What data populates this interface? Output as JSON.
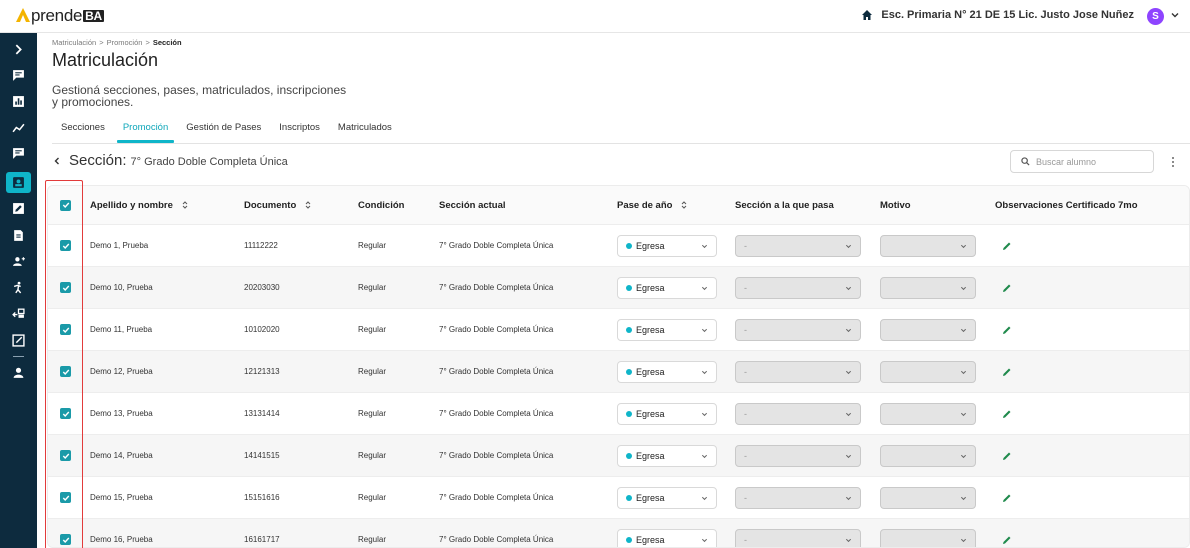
{
  "app": {
    "logo_text": "prende",
    "logo_suffix": "BA"
  },
  "header": {
    "school": "Esc. Primaria N° 21 DE 15 Lic. Justo Jose Nuñez",
    "avatar_initial": "S"
  },
  "breadcrumb": {
    "items": [
      "Matriculación",
      ">",
      "Promoción",
      ">",
      "Sección"
    ]
  },
  "page": {
    "title": "Matriculación",
    "description": "Gestioná secciones, pases, matriculados, inscripciones y promociones."
  },
  "tabs": [
    "Secciones",
    "Promoción",
    "Gestión de Pases",
    "Inscriptos",
    "Matriculados"
  ],
  "active_tab": "Promoción",
  "section": {
    "label": "Sección:",
    "name": "7° Grado Doble Completa Única"
  },
  "search": {
    "placeholder": "Buscar alumno"
  },
  "table": {
    "headers": [
      "Apellido y nombre",
      "Documento",
      "Condición",
      "Sección actual",
      "Pase de año",
      "Sección a la que pasa",
      "Motivo",
      "Observaciones Certificado 7mo"
    ],
    "rows": [
      {
        "name": "Demo 1, Prueba",
        "documento": "11112222",
        "condicion": "Regular",
        "seccion": "7° Grado Doble Completa Única",
        "pase": "Egresa",
        "seccion_pasa": "-",
        "motivo": ""
      },
      {
        "name": "Demo 10, Prueba",
        "documento": "20203030",
        "condicion": "Regular",
        "seccion": "7° Grado Doble Completa Única",
        "pase": "Egresa",
        "seccion_pasa": "-",
        "motivo": ""
      },
      {
        "name": "Demo 11, Prueba",
        "documento": "10102020",
        "condicion": "Regular",
        "seccion": "7° Grado Doble Completa Única",
        "pase": "Egresa",
        "seccion_pasa": "-",
        "motivo": ""
      },
      {
        "name": "Demo 12, Prueba",
        "documento": "12121313",
        "condicion": "Regular",
        "seccion": "7° Grado Doble Completa Única",
        "pase": "Egresa",
        "seccion_pasa": "-",
        "motivo": ""
      },
      {
        "name": "Demo 13, Prueba",
        "documento": "13131414",
        "condicion": "Regular",
        "seccion": "7° Grado Doble Completa Única",
        "pase": "Egresa",
        "seccion_pasa": "-",
        "motivo": ""
      },
      {
        "name": "Demo 14, Prueba",
        "documento": "14141515",
        "condicion": "Regular",
        "seccion": "7° Grado Doble Completa Única",
        "pase": "Egresa",
        "seccion_pasa": "-",
        "motivo": ""
      },
      {
        "name": "Demo 15, Prueba",
        "documento": "15151616",
        "condicion": "Regular",
        "seccion": "7° Grado Doble Completa Única",
        "pase": "Egresa",
        "seccion_pasa": "-",
        "motivo": ""
      },
      {
        "name": "Demo 16, Prueba",
        "documento": "16161717",
        "condicion": "Regular",
        "seccion": "7° Grado Doble Completa Única",
        "pase": "Egresa",
        "seccion_pasa": "-",
        "motivo": ""
      }
    ]
  },
  "colors": {
    "accent": "#0fb5c9",
    "sidebar": "#0d2b3e",
    "checkbox": "#1a9aa8",
    "highlight": "#e23b3b"
  },
  "sidebar_icons": [
    "expand-icon",
    "chat-icon",
    "bar-chart-icon",
    "trend-icon",
    "chat-icon",
    "id-card-icon",
    "edit-box-icon",
    "document-icon",
    "add-user-icon",
    "person-walk-icon",
    "swap-icon",
    "external-edit-icon",
    "profile-icon"
  ]
}
